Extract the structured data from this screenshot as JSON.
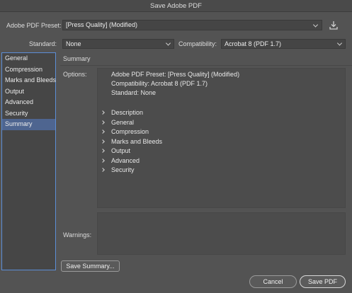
{
  "window": {
    "title": "Save Adobe PDF"
  },
  "preset": {
    "label": "Adobe PDF Preset:",
    "value": "[Press Quality] (Modified)"
  },
  "standard": {
    "label": "Standard:",
    "value": "None"
  },
  "compatibility": {
    "label": "Compatibility:",
    "value": "Acrobat 8 (PDF 1.7)"
  },
  "sidebar": {
    "items": [
      {
        "label": "General"
      },
      {
        "label": "Compression"
      },
      {
        "label": "Marks and Bleeds"
      },
      {
        "label": "Output"
      },
      {
        "label": "Advanced"
      },
      {
        "label": "Security"
      },
      {
        "label": "Summary"
      }
    ],
    "selected": "Summary"
  },
  "panel": {
    "title": "Summary",
    "options_label": "Options:",
    "options_lines": [
      "Adobe PDF Preset: [Press Quality] (Modified)",
      "Compatibility: Acrobat 8 (PDF 1.7)",
      "Standard: None"
    ],
    "tree_items": [
      "Description",
      "General",
      "Compression",
      "Marks and Bleeds",
      "Output",
      "Advanced",
      "Security"
    ],
    "warnings_label": "Warnings:"
  },
  "buttons": {
    "save_summary": "Save Summary...",
    "cancel": "Cancel",
    "save_pdf": "Save PDF"
  },
  "colors": {
    "background": "#535353",
    "selection": "#4e6590",
    "sidebar_border": "#5c8ed6"
  }
}
